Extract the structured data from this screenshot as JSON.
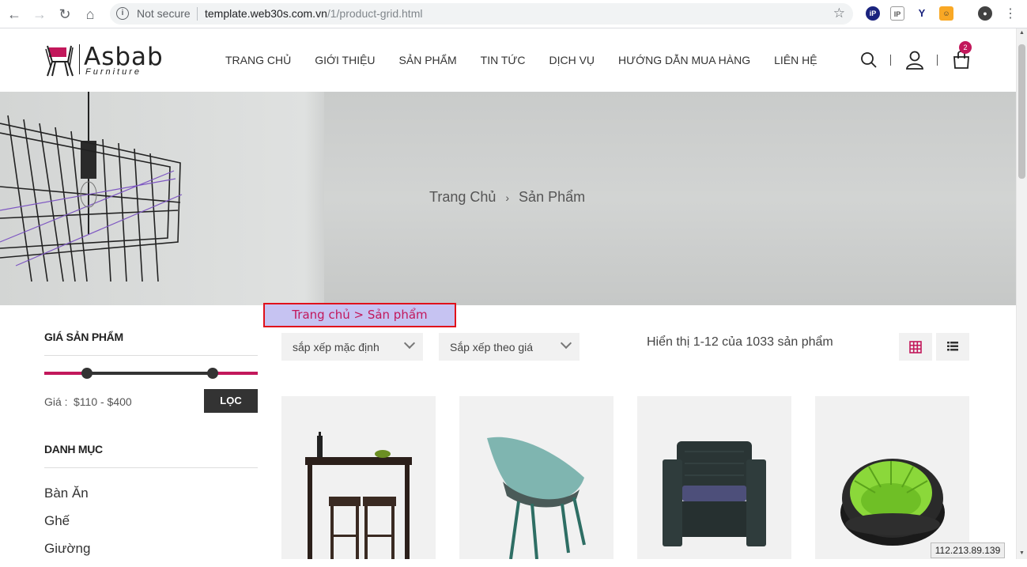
{
  "browser": {
    "not_secure": "Not secure",
    "url_host": "template.web30s.com.vn",
    "url_path": "/1/product-grid.html"
  },
  "header": {
    "logo_text": "Asbab",
    "logo_sub": "Furniture",
    "nav": [
      "TRANG CHỦ",
      "GIỚI THIỆU",
      "SẢN PHẨM",
      "TIN TỨC",
      "DỊCH VỤ",
      "HƯỚNG DẪN MUA HÀNG",
      "LIÊN HỆ"
    ],
    "cart_count": "2"
  },
  "hero": {
    "crumb_home": "Trang Chủ",
    "crumb_sep": "›",
    "crumb_current": "Sản Phẩm"
  },
  "overlay_breadcrumb": "Trang chủ > Sản phẩm",
  "sidebar": {
    "price_title": "GIÁ SẢN PHẨM",
    "price_label": "Giá :",
    "price_value": "$110 - $400",
    "price_range": [
      110,
      400
    ],
    "filter_button": "LỌC",
    "category_title": "DANH MỤC",
    "categories": [
      "Bàn Ăn",
      "Ghế",
      "Giường"
    ]
  },
  "toolbar": {
    "sort_default": "sắp xếp mặc định",
    "sort_price": "Sắp xếp theo giá",
    "result_count": "Hiển thị 1-12 của 1033 sản phẩm"
  },
  "products": [
    {
      "icon": "bar-table-set"
    },
    {
      "icon": "teal-chair"
    },
    {
      "icon": "wicker-armchair"
    },
    {
      "icon": "inflatable-chair"
    }
  ],
  "ip_tag": "112.213.89.139",
  "colors": {
    "accent": "#c2185b",
    "dark": "#333333"
  }
}
